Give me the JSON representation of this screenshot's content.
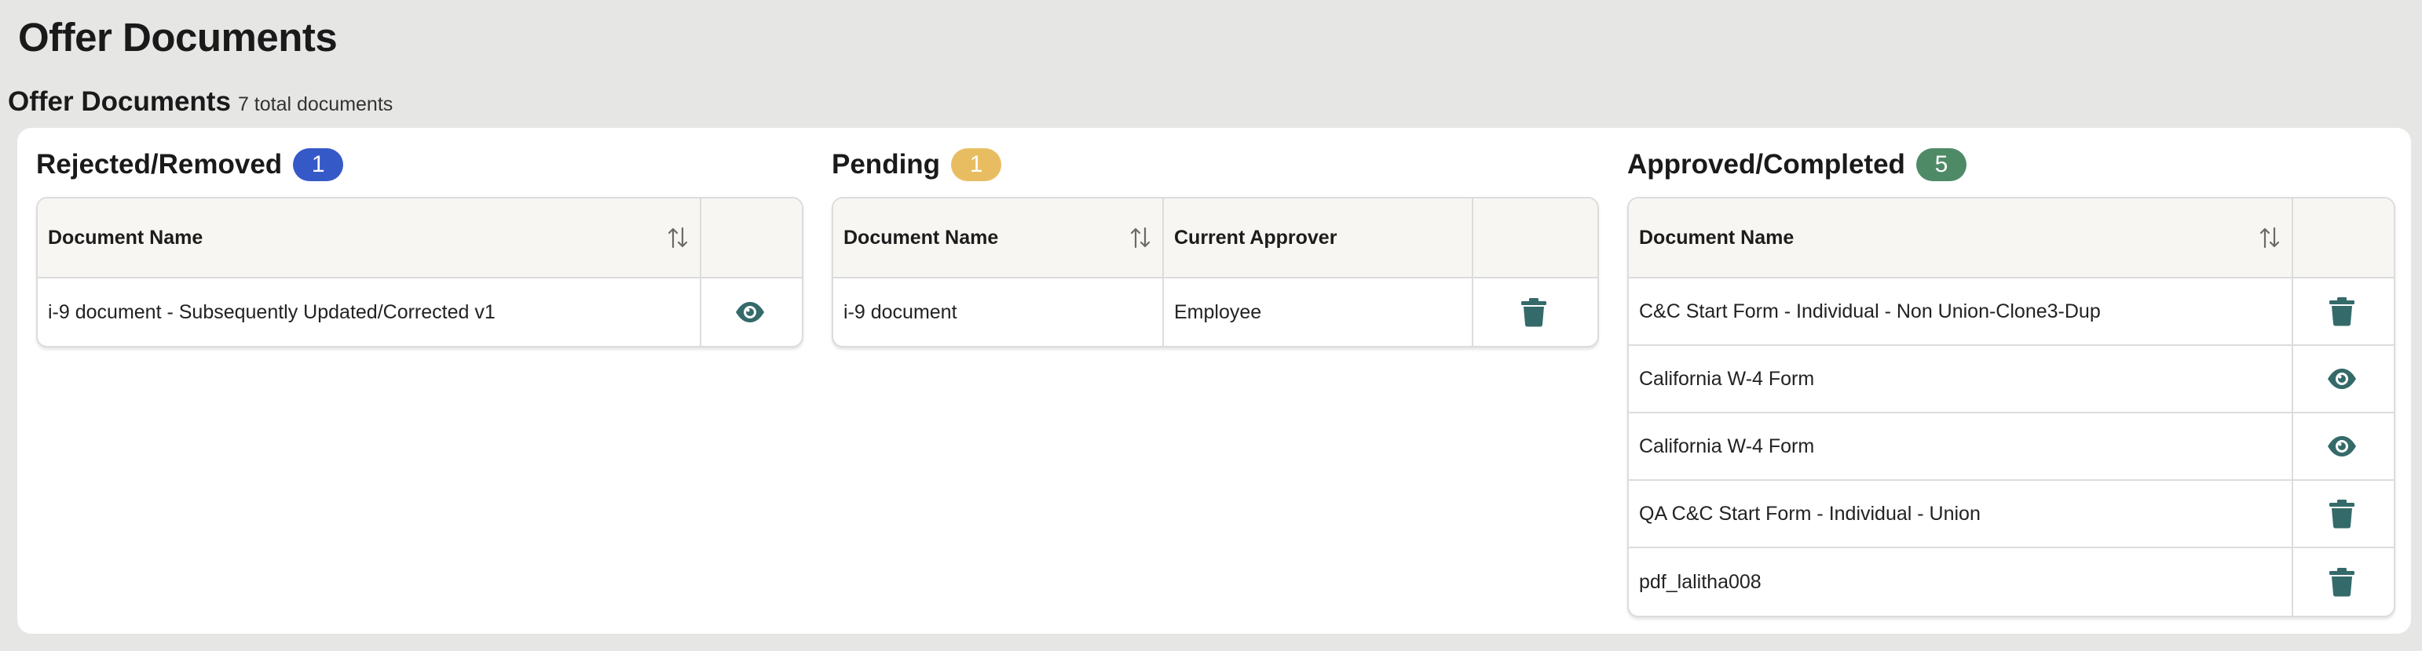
{
  "page": {
    "title": "Offer Documents"
  },
  "summary": {
    "title": "Offer Documents",
    "count_text": "7 total documents"
  },
  "colors": {
    "teal_icon": "#356a6a",
    "badge_blue": "#3659c8",
    "badge_amber": "#e8bd62",
    "badge_green": "#4f8a67"
  },
  "sections": {
    "rejected": {
      "title": "Rejected/Removed",
      "count": "1",
      "columns": [
        "Document Name"
      ],
      "rows": [
        {
          "name": "i-9 document - Subsequently Updated/Corrected v1",
          "action": "view-icon"
        }
      ]
    },
    "pending": {
      "title": "Pending",
      "count": "1",
      "columns": [
        "Document Name",
        "Current Approver"
      ],
      "rows": [
        {
          "name": "i-9 document",
          "approver": "Employee",
          "action": "trash-icon"
        }
      ]
    },
    "approved": {
      "title": "Approved/Completed",
      "count": "5",
      "columns": [
        "Document Name"
      ],
      "rows": [
        {
          "name": "C&C Start Form - Individual - Non Union-Clone3-Dup",
          "action": "trash-icon"
        },
        {
          "name": "California W-4 Form",
          "action": "view-icon"
        },
        {
          "name": "California W-4 Form",
          "action": "view-icon"
        },
        {
          "name": "QA C&C Start Form - Individual - Union",
          "action": "trash-icon"
        },
        {
          "name": "pdf_lalitha008",
          "action": "trash-icon"
        }
      ]
    }
  }
}
